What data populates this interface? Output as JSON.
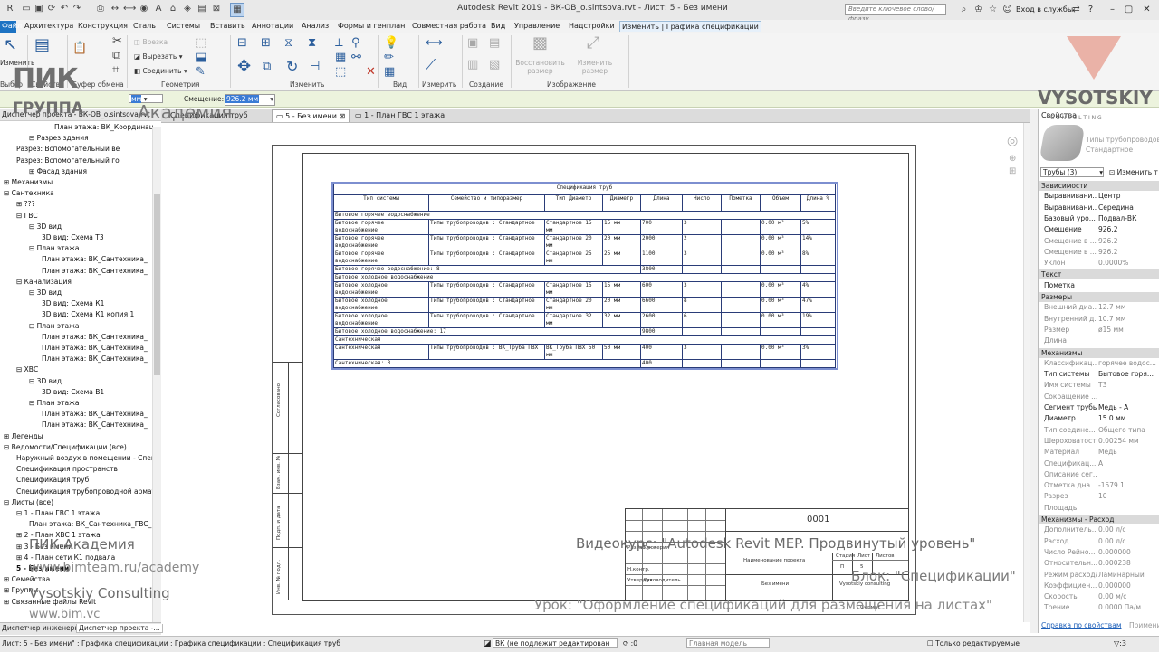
{
  "app": {
    "title": "Autodesk Revit 2019 -  ВК-ОВ_o.sintsova.rvt - Лист: 5 - Без имени",
    "search_placeholder": "Введите ключевое слово/фразу",
    "signin": "Вход в службы"
  },
  "menu": [
    "Файл",
    "Архитектура",
    "Конструкция",
    "Сталь",
    "Системы",
    "Вставить",
    "Аннотации",
    "Анализ",
    "Формы и генплан",
    "Совместная работа",
    "Вид",
    "Управление",
    "Надстройки",
    "Изменить | Графика спецификации"
  ],
  "ribbon": {
    "buttons": {
      "modify": "Изменить",
      "cut_disabled": "Врезка",
      "cut": "Вырезать",
      "join": "Соединить",
      "restore_size": "Восстановить размер",
      "change_size": "Изменить размер"
    },
    "groups": [
      "Выбор",
      "Свойства",
      "Буфер обмена",
      "Геометрия",
      "Изменить",
      "Вид",
      "Измерить",
      "Создание",
      "Изображение"
    ]
  },
  "options_bar": {
    "unit": "мм",
    "offset_label": "Смещение:",
    "offset_value": "926.2 мм"
  },
  "browser": {
    "title": "Диспетчер проекта - ВК-ОВ_o.sintsova.rvt",
    "items": [
      "План этажа: ВК_Координац",
      "Разрез здания",
      "Разрез: Вспомогательный ве",
      "Разрез: Вспомогательный го",
      "Фасад здания",
      "Механизмы",
      "Сантехника",
      "???",
      "ГВС",
      "3D вид",
      "3D вид: Схема Т3",
      "План этажа",
      "План этажа: ВК_Сантехника_",
      "План этажа: ВК_Сантехника_",
      "Канализация",
      "3D вид",
      "3D вид: Схема К1",
      "3D вид: Схема К1 копия 1",
      "План этажа",
      "План этажа: ВК_Сантехника_",
      "План этажа: ВК_Сантехника_",
      "План этажа: ВК_Сантехника_",
      "ХВС",
      "3D вид",
      "3D вид: Схема В1",
      "План этажа",
      "План этажа: ВК_Сантехника_",
      "План этажа: ВК_Сантехника_",
      "Легенды",
      "Ведомости/Спецификации (все)",
      "Наружный воздух в помещении - Специ",
      "Спецификация пространств",
      "Спецификация труб",
      "Спецификация трубопроводной армату",
      "Листы (все)",
      "1 - План ГВС 1 этажа",
      "План этажа: ВК_Сантехника_ГВС_",
      "2 - План ХВС 1 этажа",
      "3 - Без имени",
      "4 - План сети К1 подвала",
      "5 - Без имени",
      "Семейства",
      "Группы",
      "Связанные файлы Revit"
    ],
    "tabs": [
      "Диспетчер инженерн...",
      "Диспетчер проекта -..."
    ]
  },
  "view_tabs": [
    {
      "label": "Спецификация труб"
    },
    {
      "label": "5 - Без имени"
    },
    {
      "label": "1 - План ГВС 1 этажа"
    }
  ],
  "schedule": {
    "title": "Спецификация труб",
    "headers": [
      "Тип системы",
      "Семейство и типоразмер",
      "Тип Диаметр",
      "Диаметр",
      "Длина",
      "Число",
      "Пометка",
      "Объем",
      "Длина %"
    ],
    "rows": [
      {
        "kind": "group",
        "cells": [
          "Бытовое горячее водоснабжение"
        ]
      },
      {
        "kind": "data",
        "cells": [
          "Бытовое горячее водоснабжение",
          "Типы трубопроводов : Стандартное",
          "Стандартное 15 мм",
          "15 мм",
          "700",
          "3",
          "",
          "0.00 м³",
          "5%"
        ]
      },
      {
        "kind": "data",
        "cells": [
          "Бытовое горячее водоснабжение",
          "Типы трубопроводов : Стандартное",
          "Стандартное 20 мм",
          "20 мм",
          "2000",
          "2",
          "",
          "0.00 м³",
          "14%"
        ]
      },
      {
        "kind": "data",
        "cells": [
          "Бытовое горячее водоснабжение",
          "Типы трубопроводов : Стандартное",
          "Стандартное 25 мм",
          "25 мм",
          "1100",
          "3",
          "",
          "0.00 м³",
          "8%"
        ]
      },
      {
        "kind": "total",
        "cells": [
          "Бытовое горячее водоснабжение: 8",
          "",
          "",
          "",
          "3800",
          "",
          "",
          "",
          ""
        ]
      },
      {
        "kind": "group",
        "cells": [
          "Бытовое холодное водоснабжение"
        ]
      },
      {
        "kind": "data",
        "cells": [
          "Бытовое холодное водоснабжение",
          "Типы трубопроводов : Стандартное",
          "Стандартное 15 мм",
          "15 мм",
          "600",
          "3",
          "",
          "0.00 м³",
          "4%"
        ]
      },
      {
        "kind": "data",
        "cells": [
          "Бытовое холодное водоснабжение",
          "Типы трубопроводов : Стандартное",
          "Стандартное 20 мм",
          "20 мм",
          "6600",
          "8",
          "",
          "0.00 м³",
          "47%"
        ]
      },
      {
        "kind": "data",
        "cells": [
          "Бытовое холодное водоснабжение",
          "Типы трубопроводов : Стандартное",
          "Стандартное 32 мм",
          "32 мм",
          "2600",
          "6",
          "",
          "0.00 м³",
          "19%"
        ]
      },
      {
        "kind": "total",
        "cells": [
          "Бытовое холодное водоснабжение: 17",
          "",
          "",
          "",
          "9800",
          "",
          "",
          "",
          ""
        ]
      },
      {
        "kind": "group",
        "cells": [
          "Сантехническая"
        ]
      },
      {
        "kind": "data",
        "cells": [
          "Сантехническая",
          "Типы трубопроводов : ВК_Труба ПВХ",
          "ВК_Труба ПВХ 50 мм",
          "50 мм",
          "400",
          "3",
          "",
          "0.00 м³",
          "3%"
        ]
      },
      {
        "kind": "total",
        "cells": [
          "Сантехническая: 3",
          "",
          "",
          "",
          "400",
          "",
          "",
          "",
          ""
        ]
      }
    ]
  },
  "title_block": {
    "code": "0001",
    "project_name": "Наименование проекта",
    "stage_label": "Стадия",
    "sheet_label": "Лист",
    "sheets_label": "Листов",
    "stage": "П",
    "sheet": "5",
    "sheet_name": "Без имени",
    "company": "Vysotskiy consulting",
    "format": "Формат",
    "developed": "Разраб.",
    "checked": "Проверил",
    "ncontrol": "Н.контр.",
    "approved": "Утвердил",
    "approved_person": "Руководитель",
    "side_labels": [
      "Согласовано",
      "Взам. инв. №",
      "Подп. и дата",
      "Инв. № подл."
    ]
  },
  "properties": {
    "title": "Свойства",
    "type_name": "Типы трубопроводов",
    "type_sub": "Стандартное",
    "selector": "Трубы (3)",
    "edit_type": "Изменить т",
    "sections": [
      {
        "name": "Зависимости",
        "rows": [
          [
            "Выравнивани...",
            "Центр",
            false
          ],
          [
            "Выравнивани...",
            "Середина",
            false
          ],
          [
            "Базовый уро...",
            "Подвал-ВК",
            false
          ],
          [
            "Смещение",
            "926.2",
            false
          ],
          [
            "Смещение в ...",
            "926.2",
            true
          ],
          [
            "Смещение в ...",
            "926.2",
            true
          ],
          [
            "Уклон",
            "0.0000%",
            true
          ]
        ]
      },
      {
        "name": "Текст",
        "rows": [
          [
            "Пометка",
            "",
            false
          ]
        ]
      },
      {
        "name": "Размеры",
        "rows": [
          [
            "Внешний диа...",
            "12.7 мм",
            true
          ],
          [
            "Внутренний д...",
            "10.7 мм",
            true
          ],
          [
            "Размер",
            "ø15 мм",
            true
          ],
          [
            "Длина",
            "",
            true
          ]
        ]
      },
      {
        "name": "Механизмы",
        "rows": [
          [
            "Классификац...",
            "горячее водос...",
            true
          ],
          [
            "Тип системы",
            "Бытовое горя...",
            false
          ],
          [
            "Имя системы",
            "Т3",
            true
          ],
          [
            "Сокращение ...",
            "",
            true
          ],
          [
            "Сегмент трубы",
            "Медь - А",
            false
          ],
          [
            "Диаметр",
            "15.0 мм",
            false
          ],
          [
            "Тип соедине...",
            "Общего типа",
            true
          ],
          [
            "Шероховатость",
            "0.00254 мм",
            true
          ],
          [
            "Материал",
            "Медь",
            true
          ],
          [
            "Спецификац...",
            "А",
            true
          ],
          [
            "Описание сег...",
            "",
            true
          ],
          [
            "Отметка дна",
            "-1579.1",
            true
          ],
          [
            "Разрез",
            "10",
            true
          ],
          [
            "Площадь",
            "",
            true
          ]
        ]
      },
      {
        "name": "Механизмы - Расход",
        "rows": [
          [
            "Дополнитель...",
            "0.00 л/с",
            true
          ],
          [
            "Расход",
            "0.00 л/с",
            true
          ],
          [
            "Число Рейно...",
            "0.000000",
            true
          ],
          [
            "Относительн...",
            "0.000238",
            true
          ],
          [
            "Режим расхода",
            "Ламинарный",
            true
          ],
          [
            "Коэффициен...",
            "0.000000",
            true
          ],
          [
            "Скорость",
            "0.00 м/с",
            true
          ],
          [
            "Трение",
            "0.0000 Па/м",
            true
          ]
        ]
      }
    ],
    "help_link": "Справка по свойствам",
    "apply": "Примени"
  },
  "statusbar": {
    "text": "Лист: 5 - Без имени\" : Графика спецификации : Графика спецификации : Спецификация труб",
    "workset": "ВК (не подлежит редактирован",
    "zero": ":0",
    "model": "Главная модель",
    "editable_only": "Только редактируемые"
  },
  "watermark": {
    "brand_top": "ПИК",
    "brand_bottom": "ГРУППА",
    "academy": "Академия",
    "vys": "VYSOTSKIY",
    "vys_sub": "C O N S U L T I N G",
    "course": "Видеокурс: \"Autodesk Revit MEP. Продвинутый уровень\"",
    "block": "Блок: \"Спецификации\"",
    "lesson": "Урок: \"Оформление спецификаций для размещения на листах\"",
    "pik_academy": "ПИК-Академия",
    "bimteam": "www.bimteam.ru/academy",
    "vysconsult": "Vysotskiy Consulting",
    "bimvc": "www.bim.vc"
  },
  "colors": {
    "accent": "#1d73c3",
    "schedule_lines": "#2a3c78",
    "options_bar": "#ecf3dd"
  }
}
